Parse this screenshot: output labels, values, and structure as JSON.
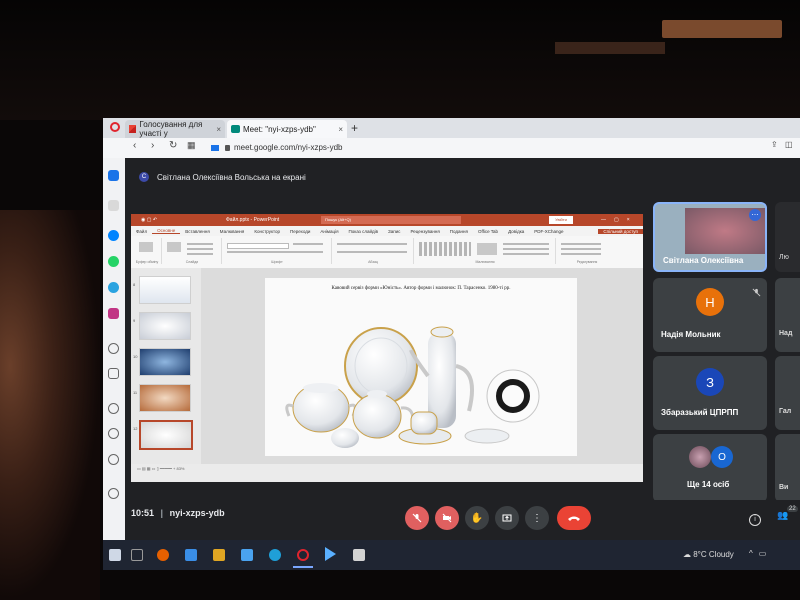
{
  "browser": {
    "tabs": [
      {
        "label": "Голосування для участі у",
        "icon": "gmail-icon"
      },
      {
        "label": "Meet: \"nyi-xzps-ydb\"",
        "icon": "meet-icon"
      }
    ],
    "url": "meet.google.com/nyi-xzps-ydb"
  },
  "meet": {
    "presenter_initial": "С",
    "presenter_text": "Світлана Олексіївна Вольська на екрані",
    "meeting_time": "10:51",
    "meeting_code": "nyi-xzps-ydb",
    "participant_count": "22"
  },
  "powerpoint": {
    "title": "Файл.pptx - PowerPoint",
    "search": "Пошук (Alt+Q)",
    "signin": "Увійти",
    "menu": [
      "Файл",
      "Основне",
      "Вставлення",
      "Малювання",
      "Конструктор",
      "Переходи",
      "Анімація",
      "Показ слайдів",
      "Запис",
      "Рецензування",
      "Подання",
      "Office Tab",
      "Довідка",
      "PDF-XChange",
      "Спільний доступ"
    ],
    "ribbon_groups": [
      "Буфер обміну",
      "Слайди",
      "Шрифт",
      "Абзац",
      "Малювання",
      "Редагування"
    ],
    "slide_numbers": [
      "8",
      "9",
      "10",
      "11",
      "12"
    ],
    "slide_caption": "Кавовий сервіз форми «Юність». Автор форми і малюнок: П. Тарасенко. 1980-ті рр."
  },
  "participants": [
    {
      "name": "Світлана Олексіївна",
      "type": "video"
    },
    {
      "name": "Надія Мольник",
      "initial": "Н",
      "color": "#e8710a"
    },
    {
      "name": "Збаразький ЦПРПП",
      "initial": "З",
      "color": "#1a47b8"
    },
    {
      "name": "Ще 14 осіб",
      "initial": "О",
      "color": "#1967d2"
    }
  ],
  "right_partial": [
    "Лю",
    "Над",
    "Гал",
    "Ви"
  ],
  "taskbar": {
    "weather": "8°C Cloudy"
  },
  "colors": {
    "meet_bg": "#202124",
    "tile_bg": "#3c4043",
    "ppt_accent": "#b7472a",
    "hangup": "#ea4335",
    "mic_off": "#e06060"
  }
}
